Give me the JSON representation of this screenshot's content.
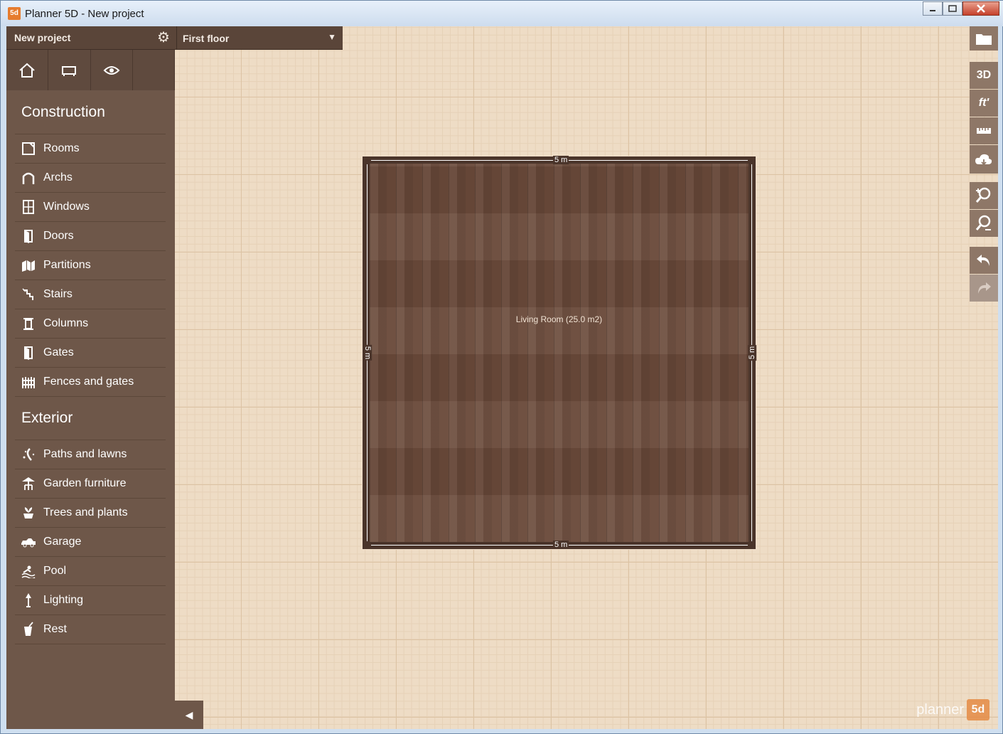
{
  "window": {
    "title": "Planner 5D - New project",
    "icon_text": "5d"
  },
  "topbar": {
    "project_name": "New project",
    "floor_label": "First floor"
  },
  "sidebar": {
    "construction_title": "Construction",
    "construction_items": [
      {
        "label": "Rooms",
        "icon": "rooms-icon"
      },
      {
        "label": "Archs",
        "icon": "archs-icon"
      },
      {
        "label": "Windows",
        "icon": "windows-icon"
      },
      {
        "label": "Doors",
        "icon": "doors-icon"
      },
      {
        "label": "Partitions",
        "icon": "partitions-icon"
      },
      {
        "label": "Stairs",
        "icon": "stairs-icon"
      },
      {
        "label": "Columns",
        "icon": "columns-icon"
      },
      {
        "label": "Gates",
        "icon": "gates-icon"
      },
      {
        "label": "Fences and gates",
        "icon": "fences-icon"
      }
    ],
    "exterior_title": "Exterior",
    "exterior_items": [
      {
        "label": "Paths and lawns",
        "icon": "paths-icon"
      },
      {
        "label": "Garden furniture",
        "icon": "garden-furniture-icon"
      },
      {
        "label": "Trees and plants",
        "icon": "plants-icon"
      },
      {
        "label": "Garage",
        "icon": "car-icon"
      },
      {
        "label": "Pool",
        "icon": "swimmer-icon"
      },
      {
        "label": "Lighting",
        "icon": "lamp-icon"
      },
      {
        "label": "Rest",
        "icon": "drink-icon"
      }
    ]
  },
  "toolbar": {
    "view_3d": "3D",
    "units": "ft'"
  },
  "room": {
    "label": "Living Room (25.0 m2)",
    "dim_top": "5 m",
    "dim_bottom": "5 m",
    "dim_left": "5 m",
    "dim_right": "5 m"
  },
  "logo": {
    "text": "planner",
    "box": "5d"
  }
}
